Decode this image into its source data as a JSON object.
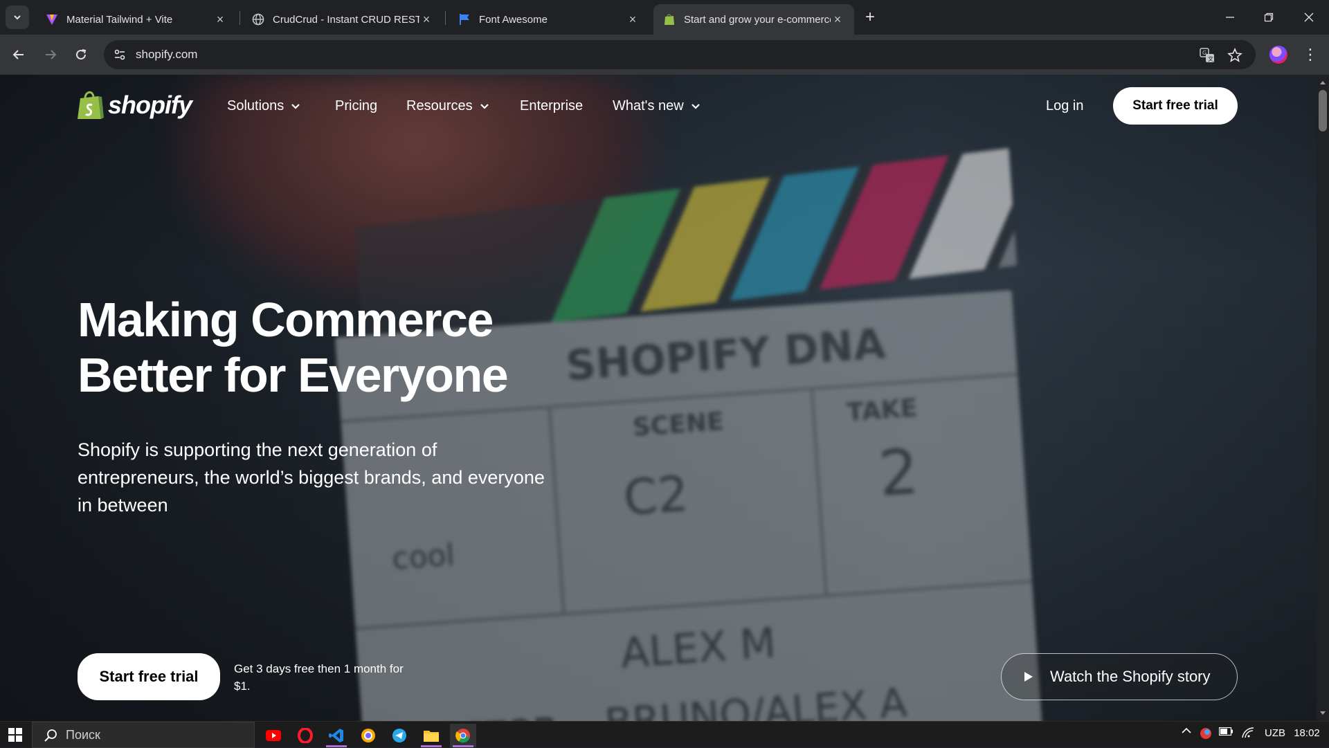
{
  "browser": {
    "tabs": [
      {
        "title": "Material Tailwind + Vite",
        "icon": "vite-icon"
      },
      {
        "title": "CrudCrud - Instant CRUD REST",
        "icon": "globe-icon"
      },
      {
        "title": "Font Awesome",
        "icon": "flag-icon"
      },
      {
        "title": "Start and grow your e-commerce",
        "icon": "shopify-bag-icon",
        "active": true
      }
    ],
    "url": "shopify.com"
  },
  "site": {
    "logo_text": "shopify",
    "nav": {
      "solutions": "Solutions",
      "pricing": "Pricing",
      "resources": "Resources",
      "enterprise": "Enterprise",
      "whats_new": "What's new"
    },
    "login": "Log in",
    "header_cta": "Start free trial",
    "hero": {
      "title_line1": "Making Commerce",
      "title_line2": "Better for Everyone",
      "subtitle": "Shopify is supporting the next generation of entrepreneurs, the world’s biggest brands, and everyone in between",
      "cta": "Start free trial",
      "offer": "Get 3 days free then 1 month for $1.",
      "watch": "Watch the Shopify story"
    },
    "background": {
      "board_title": "SHOPIFY DNA",
      "scene_label": "SCENE",
      "scene_value": "C2",
      "take_label": "TAKE",
      "take_value": "2",
      "director_label": "DIRECTOR",
      "name1": "ALEX M",
      "name2": "BRUNO/ALEX A",
      "prod": "cool"
    }
  },
  "taskbar": {
    "search_placeholder": "Поиск",
    "language": "UZB",
    "time": "18:02"
  },
  "colors": {
    "shopify_green": "#95bf47",
    "clap_stripes": [
      "#2e9e57",
      "#d4c13a",
      "#2a97b8",
      "#c7245a",
      "#e6e6e6",
      "#8c8f93"
    ]
  }
}
